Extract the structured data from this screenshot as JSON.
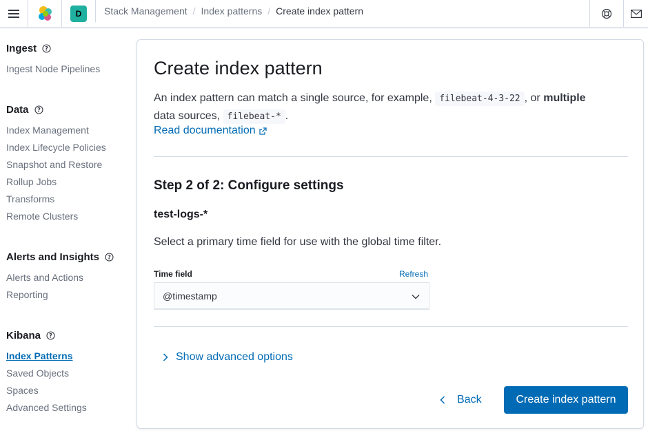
{
  "header": {
    "space_initial": "D",
    "breadcrumbs": [
      "Stack Management",
      "Index patterns",
      "Create index pattern"
    ],
    "icons": [
      "menu-icon",
      "elastic-logo-icon",
      "help-icon",
      "mail-icon"
    ]
  },
  "sidebar": {
    "groups": [
      {
        "title": "Ingest",
        "items": [
          "Ingest Node Pipelines"
        ]
      },
      {
        "title": "Data",
        "items": [
          "Index Management",
          "Index Lifecycle Policies",
          "Snapshot and Restore",
          "Rollup Jobs",
          "Transforms",
          "Remote Clusters"
        ]
      },
      {
        "title": "Alerts and Insights",
        "items": [
          "Alerts and Actions",
          "Reporting"
        ]
      },
      {
        "title": "Kibana",
        "items": [
          "Index Patterns",
          "Saved Objects",
          "Spaces",
          "Advanced Settings"
        ]
      }
    ],
    "active_item": "Index Patterns"
  },
  "main": {
    "title": "Create index pattern",
    "description_part1": "An index pattern can match a single source, for example,",
    "code1": "filebeat-4-3-22",
    "description_part2": ", or",
    "description_bold": "multiple",
    "description_part3": "data sources,",
    "code2": "filebeat-*",
    "description_end": ".",
    "doc_link": "Read documentation",
    "step_title": "Step 2 of 2: Configure settings",
    "pattern_name": "test-logs-*",
    "select_description": "Select a primary time field for use with the global time filter.",
    "time_field_label": "Time field",
    "refresh_label": "Refresh",
    "time_field_value": "@timestamp",
    "advanced_label": "Show advanced options",
    "back_label": "Back",
    "create_label": "Create index pattern"
  },
  "colors": {
    "accent": "#006bb4",
    "space_avatar": "#20b09f"
  }
}
